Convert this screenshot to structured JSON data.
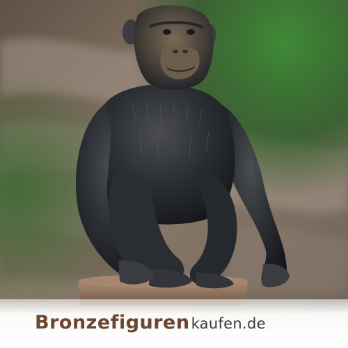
{
  "logo": {
    "brand": "Bronzefiguren",
    "domain": "kaufen.de"
  },
  "colors": {
    "brand_text": "#6b4630",
    "domain_text": "#3a3a3a",
    "bronze_dark": "#1f2227",
    "bronze_mid": "#3a3d42",
    "bronze_highlight": "#7a6a55",
    "foliage": "#2f6b2a",
    "bark": "#8a7868"
  },
  "icons": {
    "statue": "chimpanzee-bronze-statue"
  }
}
